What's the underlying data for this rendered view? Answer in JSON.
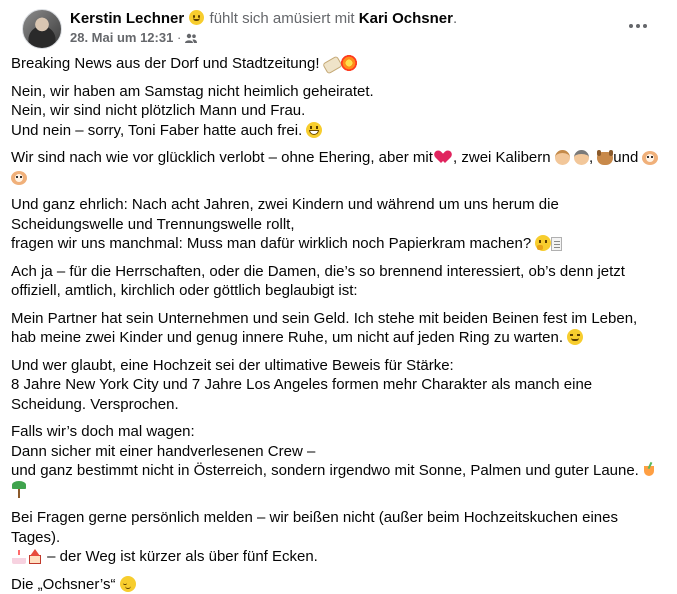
{
  "post": {
    "author": "Kerstin Lechner",
    "feeling_text": "fühlt sich amüsiert mit",
    "tagged": "Kari Ochsner",
    "tagged_suffix": ".",
    "date": "28. Mai um 12:31",
    "date_sep": " · ",
    "audience_icon": "friends-icon",
    "more_icon": "more-options-icon"
  },
  "paragraphs": {
    "p1": "Breaking News aus der Dorf und Stadtzeitung!",
    "p2_l1": "Nein, wir haben am Samstag nicht heimlich geheiratet.",
    "p2_l2": "Nein, wir sind nicht plötzlich Mann und Frau.",
    "p2_l3": "Und nein – sorry, Toni Faber hatte auch frei.",
    "p3_a": "Wir sind nach wie vor glücklich verlobt – ohne Ehering, aber mit",
    "p3_b": ", zwei Kalibern",
    "p3_c": ",",
    "p3_d": "und",
    "p4_l1": "Und ganz ehrlich: Nach acht Jahren, zwei Kindern und während um uns herum die Scheidungswelle und Trennungswelle rollt,",
    "p4_l2": "fragen wir uns manchmal: Muss man dafür wirklich noch Papierkram machen?",
    "p5": "Ach ja – für die Herrschaften, oder die Damen, die’s so brennend interessiert, ob’s denn jetzt offiziell, amtlich, kirchlich oder göttlich beglaubigt ist:",
    "p6": "Mein Partner hat sein Unternehmen und sein Geld. Ich stehe mit beiden Beinen fest im Leben, hab meine zwei Kinder und genug innere Ruhe, um nicht auf jeden Ring zu warten.",
    "p7_l1": "Und wer glaubt, eine Hochzeit sei der ultimative Beweis für Stärke:",
    "p7_l2": "8 Jahre New York City und 7 Jahre Los Angeles formen mehr Charakter als manch eine Scheidung. Versprochen.",
    "p8_l1": "Falls wir’s doch mal wagen:",
    "p8_l2": "Dann sicher mit einer handverlesenen Crew –",
    "p8_l3": "und ganz bestimmt nicht in Österreich, sondern irgendwo mit Sonne, Palmen und guter Laune.",
    "p9_l1": "Bei Fragen gerne persönlich melden – wir beißen nicht (außer beim Hochzeitskuchen eines Tages).",
    "p9_l2": "– der Weg ist kürzer als über fünf Ecken.",
    "p10": "Die „Ochsner’s“"
  }
}
